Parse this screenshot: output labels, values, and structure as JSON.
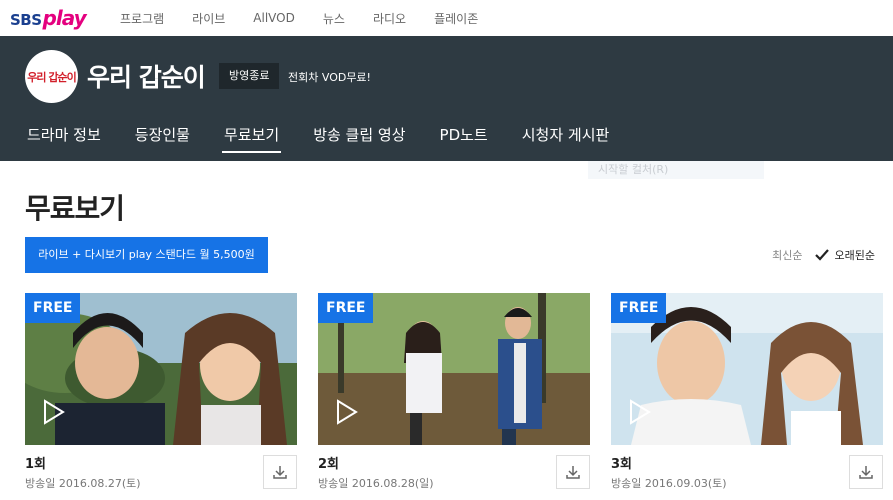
{
  "topnav": {
    "logo_sbs": "SBS",
    "logo_play": "play",
    "menu": [
      "프로그램",
      "라이브",
      "AllVOD",
      "뉴스",
      "라디오",
      "플레이존"
    ]
  },
  "program": {
    "logo_text": "우리 갑순이",
    "title": "우리 갑순이",
    "status": "방영종료",
    "notice": "전회차 VOD무료!",
    "tabs": [
      "드라마 정보",
      "등장인물",
      "무료보기",
      "방송 클립 영상",
      "PD노트",
      "시청자 게시판"
    ],
    "active_tab": "무료보기"
  },
  "overlay": {
    "ghost_text": "시작할 컬처(R)"
  },
  "main": {
    "section_title": "무료보기",
    "promo_button": "라이브 + 다시보기 play 스탠다드 월 5,500원",
    "sort": {
      "newest": "최신순",
      "oldest": "오래된순",
      "selected": "오래된순"
    },
    "episodes": [
      {
        "badge": "FREE",
        "title": "1회",
        "date": "방송일 2016.08.27(토)",
        "scene": "sky-trees",
        "icon": "download-icon"
      },
      {
        "badge": "FREE",
        "title": "2회",
        "date": "방송일 2016.08.28(일)",
        "scene": "park-trees",
        "icon": "download-icon"
      },
      {
        "badge": "FREE",
        "title": "3회",
        "date": "방송일 2016.09.03(토)",
        "scene": "bright-sky",
        "icon": "download-icon"
      }
    ]
  },
  "colors": {
    "header_bg": "#2e3a42",
    "accent_blue": "#1673e6",
    "logo_pink": "#e4007f",
    "logo_navy": "#1a3f8f"
  }
}
